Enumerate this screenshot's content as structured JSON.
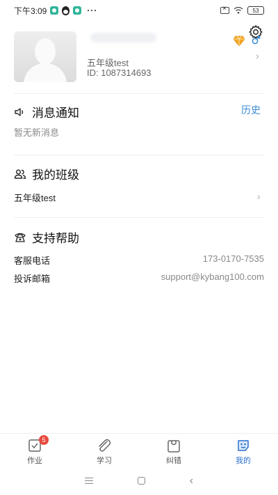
{
  "status_bar": {
    "time": "下午3:09",
    "dots": "···",
    "battery": "53"
  },
  "profile": {
    "class_name": "五年级test",
    "user_id": "ID: 1087314693"
  },
  "notifications": {
    "title": "消息通知",
    "history_label": "历史",
    "empty_text": "暂无新消息"
  },
  "my_class": {
    "title": "我的班级",
    "class_name": "五年级test"
  },
  "support": {
    "title": "支持帮助",
    "rows": [
      {
        "label": "客服电话",
        "value": "173-0170-7535"
      },
      {
        "label": "投诉邮箱",
        "value": "support@kybang100.com"
      }
    ]
  },
  "bottom_nav": {
    "items": [
      {
        "label": "作业",
        "badge": "5"
      },
      {
        "label": "学习"
      },
      {
        "label": "纠错"
      },
      {
        "label": "我的"
      }
    ]
  },
  "colors": {
    "accent": "#2d6fd1",
    "link": "#3a8bd6",
    "badge": "#e8493e"
  }
}
